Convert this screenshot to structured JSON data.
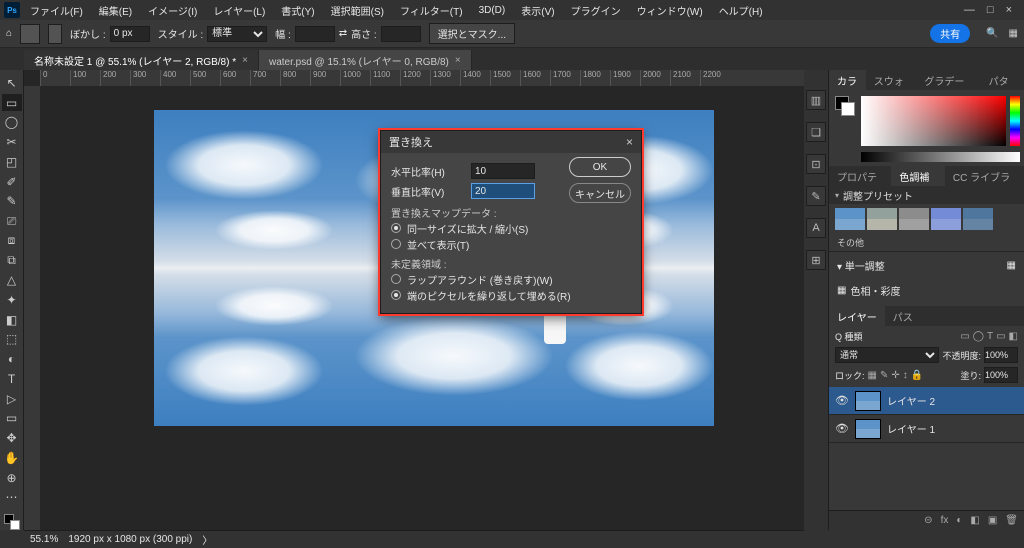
{
  "app": {
    "logo_text": "Ps"
  },
  "menu": {
    "items": [
      "ファイル(F)",
      "編集(E)",
      "イメージ(I)",
      "レイヤー(L)",
      "書式(Y)",
      "選択範囲(S)",
      "フィルター(T)",
      "3D(D)",
      "表示(V)",
      "プラグイン",
      "ウィンドウ(W)",
      "ヘルプ(H)"
    ]
  },
  "win_controls": {
    "minimize": "—",
    "maximize": "□",
    "close": "×"
  },
  "options": {
    "home_icon": "⌂",
    "blur_label": "ぼかし :",
    "blur_value": "0 px",
    "style_label": "スタイル :",
    "style_value": "標準",
    "width_label": "幅 :",
    "width_value": "",
    "swap_icon": "⇄",
    "height_label": "高さ :",
    "height_value": "",
    "mask_button": "選択とマスク...",
    "share_button": "共有"
  },
  "tabs": [
    {
      "label": "名称未設定 1 @ 55.1% (レイヤー 2, RGB/8) *",
      "active": true
    },
    {
      "label": "water.psd @ 15.1% (レイヤー 0, RGB/8)",
      "active": false
    }
  ],
  "ruler_ticks": [
    "0",
    "100",
    "200",
    "300",
    "400",
    "500",
    "600",
    "700",
    "800",
    "900",
    "1000",
    "1100",
    "1200",
    "1300",
    "1400",
    "1500",
    "1600",
    "1700",
    "1800",
    "1900",
    "2000",
    "2100",
    "2200"
  ],
  "tools": [
    "↖",
    "▭",
    "◯",
    "✂",
    "◰",
    "✐",
    "✎",
    "⎚",
    "⧈",
    "⧉",
    "△",
    "✦",
    "◧",
    "⬚",
    "◐",
    "T",
    "▷",
    "▭",
    "✥",
    "✋",
    "⊕",
    "⋯"
  ],
  "float_icons": [
    "▥",
    "❏",
    "⊡",
    "✎",
    "A",
    "⊞"
  ],
  "right": {
    "color_tabs": [
      "カラー",
      "スウォッチ",
      "グラデーション",
      "パターン"
    ],
    "prop_tabs": [
      "プロパティ",
      "色調補正",
      "CC ライブラリ"
    ],
    "adjust_header": "調整プリセット",
    "more_label": "その他",
    "simple_adjust_header": "単一調整",
    "hue_sat_icon": "▦",
    "hue_sat_label": "色相・彩度",
    "layers_tabs": [
      "レイヤー",
      "パス"
    ],
    "filter_label": "Q 種類",
    "filter_icons": [
      "▭",
      "◯",
      "T",
      "▭",
      "◧"
    ],
    "blend_label": "通常",
    "opacity_label": "不透明度:",
    "opacity_value": "100%",
    "lock_label": "ロック:",
    "lock_icons": [
      "▦",
      "✎",
      "✛",
      "↕",
      "🔒"
    ],
    "fill_label": "塗り:",
    "fill_value": "100%",
    "layers": [
      {
        "name": "レイヤー 2",
        "selected": true
      },
      {
        "name": "レイヤー 1",
        "selected": false
      }
    ],
    "layer_footer_icons": [
      "⊝",
      "fx",
      "◐",
      "◧",
      "▣",
      "🗑"
    ]
  },
  "dialog": {
    "title": "置き換え",
    "hscale_label": "水平比率(H)",
    "hscale_value": "10",
    "vscale_label": "垂直比率(V)",
    "vscale_value": "20",
    "map_label": "置き換えマップデータ :",
    "map_opt1": "同一サイズに拡大 / 縮小(S)",
    "map_opt2": "並べて表示(T)",
    "undef_label": "未定義領域 :",
    "undef_opt1": "ラップアラウンド (巻き戻す)(W)",
    "undef_opt2": "端のピクセルを繰り返して埋める(R)",
    "ok": "OK",
    "cancel": "キャンセル"
  },
  "status": {
    "zoom": "55.1%",
    "info": "1920 px x 1080 px (300 ppi)"
  }
}
